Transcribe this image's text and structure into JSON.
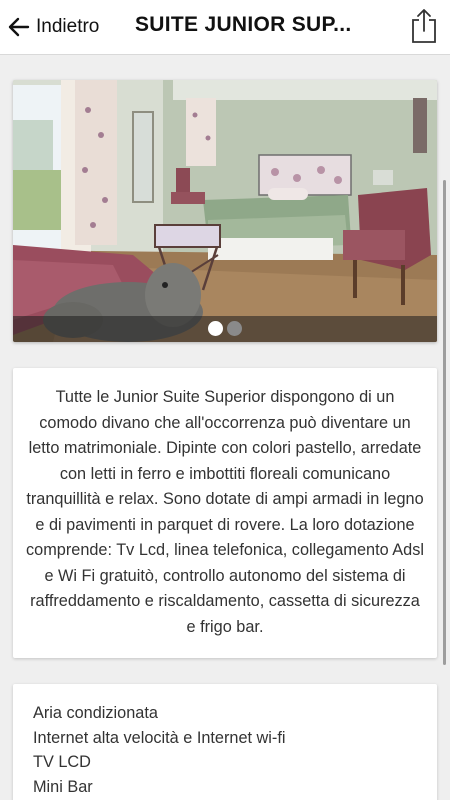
{
  "header": {
    "back_label": "Indietro",
    "title": "SUITE JUNIOR SUP...",
    "back_icon": "arrow-left-icon",
    "share_icon": "share-icon"
  },
  "carousel": {
    "image": "suite-bedroom-photo",
    "pages": 2,
    "active_page": 1
  },
  "description": "Tutte le Junior Suite Superior dispongono di un comodo divano che all'occorrenza può diventare un letto matrimoniale. Dipinte con colori pastello, arredate con letti in ferro e imbottiti floreali comunicano tranquillità e relax. Sono dotate di ampi armadi in legno e di pavimenti in parquet di rovere. La loro dotazione comprende: Tv Lcd, linea telefonica, collegamento Adsl e Wi Fi gratuitò, controllo autonomo del sistema di raffreddamento e riscaldamento, cassetta di sicurezza e frigo bar.",
  "amenities": [
    "Aria condizionata",
    "Internet alta velocità  e Internet wi-fi",
    "TV LCD",
    "Mini Bar"
  ],
  "colors": {
    "background": "#efefef",
    "card": "#ffffff",
    "text": "#333333",
    "header_text": "#111111"
  }
}
